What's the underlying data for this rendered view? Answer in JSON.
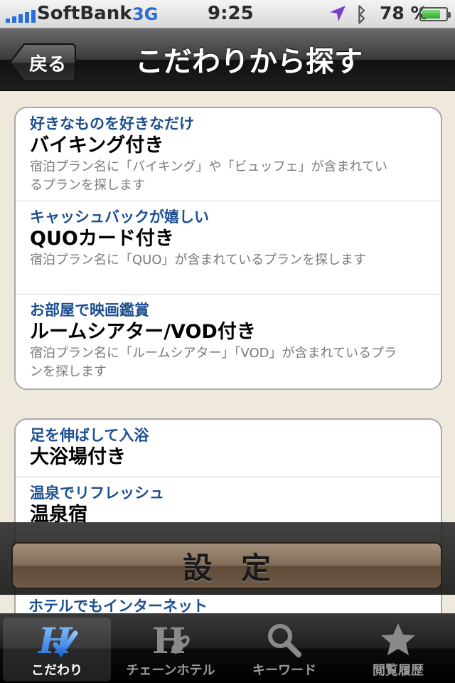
{
  "status": {
    "carrier": "SoftBank",
    "network": "3G",
    "time": "9:25",
    "battery_percent": "78 %",
    "battery_level": 0.78,
    "icons": [
      "signal-icon",
      "location-arrow-icon",
      "bluetooth-icon",
      "battery-icon"
    ]
  },
  "nav": {
    "back_label": "戻る",
    "title": "こだわりから探す"
  },
  "groups": [
    {
      "rows": [
        {
          "sub": "好きなものを好きなだけ",
          "title": "バイキング付き",
          "desc": "宿泊プラン名に「バイキング」や「ビュッフェ」が含まれているプランを探します"
        },
        {
          "sub": "キャッシュバックが嬉しい",
          "title": "QUOカード付き",
          "desc": "宿泊プラン名に「QUO」が含まれているプランを探します"
        },
        {
          "sub": "お部屋で映画鑑賞",
          "title": "ルームシアター/VOD付き",
          "desc": "宿泊プラン名に「ルームシアター」「VOD」が含まれているプランを探します"
        }
      ]
    },
    {
      "rows": [
        {
          "sub": "足を伸ばして入浴",
          "title": "大浴場付き"
        },
        {
          "sub": "温泉でリフレッシュ",
          "title": "温泉宿"
        },
        {
          "sub": "",
          "title": ""
        }
      ]
    }
  ],
  "set_button": {
    "label": "設定"
  },
  "peek_row": {
    "sub": "ホテルでもインターネット"
  },
  "tabs": [
    {
      "label": "こだわり",
      "icon": "h-check-icon",
      "active": true
    },
    {
      "label": "チェーンホテル",
      "icon": "h-chain-icon",
      "active": false
    },
    {
      "label": "キーワード",
      "icon": "magnifier-icon",
      "active": false
    },
    {
      "label": "閲覧履歴",
      "icon": "star-icon",
      "active": false
    }
  ],
  "colors": {
    "accent_blue": "#1d4f8f",
    "button_brown": "#816b56",
    "background": "#efe9dc"
  }
}
